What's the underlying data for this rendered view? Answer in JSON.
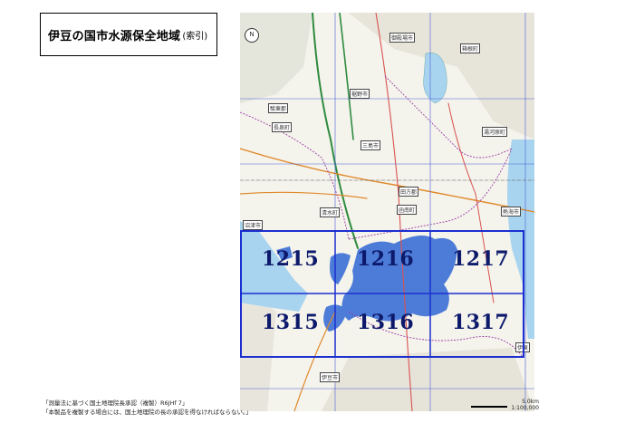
{
  "title": {
    "main": "伊豆の国市水源保全地域",
    "sub": "(索引)"
  },
  "tiles": [
    {
      "id": "1215",
      "row": 0,
      "col": 0
    },
    {
      "id": "1216",
      "row": 0,
      "col": 1
    },
    {
      "id": "1217",
      "row": 0,
      "col": 2
    },
    {
      "id": "1315",
      "row": 1,
      "col": 0
    },
    {
      "id": "1316",
      "row": 1,
      "col": 1
    },
    {
      "id": "1317",
      "row": 1,
      "col": 2
    }
  ],
  "places": {
    "susono": "裾野市",
    "nagaizumi": "長泉町",
    "shimizu": "清水町",
    "mishima": "三島市",
    "kannami": "函南町",
    "numazu": "沼津市",
    "atami": "熱海市",
    "izu": "伊豆市",
    "hakone": "箱根町",
    "yugawara": "湯河原町",
    "ito": "伊東",
    "tagata": "田方郡",
    "sunto": "駿東郡",
    "gotemba": "御殿場市"
  },
  "scale": {
    "distance": "5.0km",
    "ratio": "1:100,000"
  },
  "credit": {
    "line1": "「測量法に基づく国土地理院長承認（複製）R6JHf 7」",
    "line2": "「本製品を複製する場合には、国土地理院の長の承認を得なければならない。」"
  },
  "colors": {
    "grid": "#1c2fd0",
    "area": "#3b6fd6",
    "tile_label": "#0d1a6b",
    "sea": "#a9d4ef"
  }
}
